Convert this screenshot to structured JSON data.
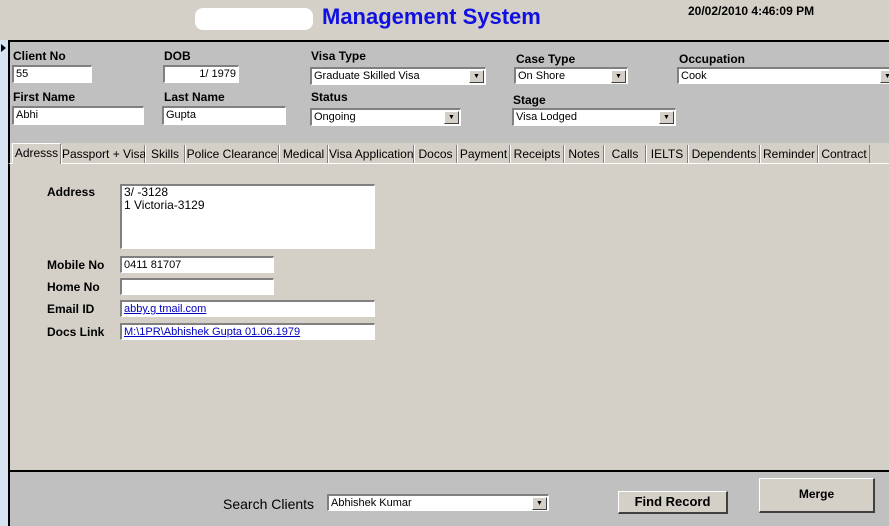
{
  "header": {
    "title": "Management System",
    "datetime": "20/02/2010 4:46:09 PM"
  },
  "fields": {
    "client_no": {
      "label": "Client No",
      "value": "55"
    },
    "dob": {
      "label": "DOB",
      "value": "1/   1979"
    },
    "visa_type": {
      "label": "Visa Type",
      "value": "Graduate Skilled Visa"
    },
    "case_type": {
      "label": "Case Type",
      "value": "On Shore"
    },
    "occupation": {
      "label": "Occupation",
      "value": "Cook"
    },
    "first_name": {
      "label": "First Name",
      "value": "Abhi"
    },
    "last_name": {
      "label": "Last Name",
      "value": "Gupta"
    },
    "status": {
      "label": "Status",
      "value": "Ongoing"
    },
    "stage": {
      "label": "Stage",
      "value": "Visa Lodged"
    }
  },
  "tabs": [
    "Adresss",
    "Passport + Visa",
    "Skills",
    "Police Clearance",
    "Medical",
    "Visa Application",
    "Docos",
    "Payment",
    "Receipts",
    "Notes",
    "Calls",
    "IELTS",
    "Dependents",
    "Reminder",
    "Contract"
  ],
  "address_tab": {
    "address": {
      "label": "Address",
      "line1": "3/          -3128",
      "line2": "1           Victoria-3129"
    },
    "mobile": {
      "label": "Mobile No",
      "value": "0411         81707"
    },
    "home": {
      "label": "Home No",
      "value": ""
    },
    "email": {
      "label": "Email ID",
      "value": "abby.g      tmail.com"
    },
    "docs": {
      "label": "Docs Link",
      "value": "M:\\1PR\\Abhishek Gupta 01.06.1979"
    }
  },
  "footer": {
    "search_label": "Search Clients",
    "search_value": "Abhishek Kumar",
    "find_label": "Find Record",
    "merge_label": "Merge"
  }
}
